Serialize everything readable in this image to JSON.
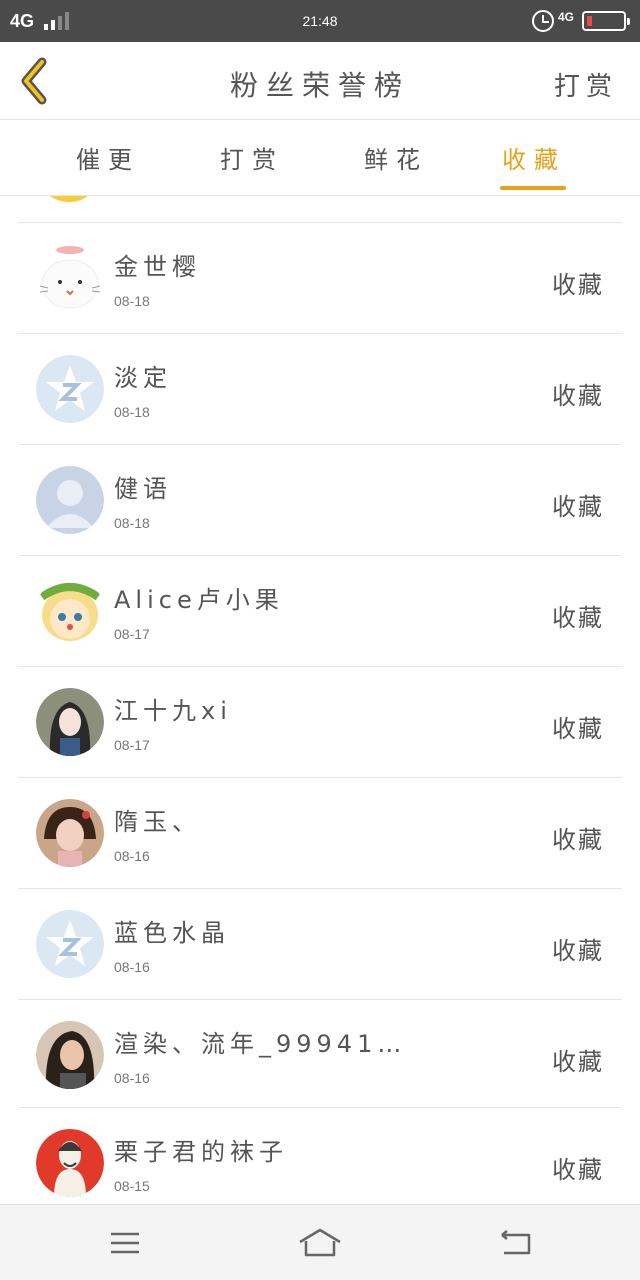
{
  "status_bar": {
    "network": "4G",
    "time": "21:48",
    "network_right": "4G",
    "icons": [
      "signal-icon",
      "alarm-icon",
      "battery-icon"
    ]
  },
  "header": {
    "back_icon": "chevron-left-icon",
    "title": "粉丝荣誉榜",
    "right_action": "打赏"
  },
  "tabs": [
    {
      "label": "催更",
      "active": false
    },
    {
      "label": "打赏",
      "active": false
    },
    {
      "label": "鲜花",
      "active": false
    },
    {
      "label": "收藏",
      "active": true
    }
  ],
  "accent_color": "#e8a21a",
  "fans": [
    {
      "name": "金世樱",
      "date": "08-18",
      "action": "收藏"
    },
    {
      "name": "淡定",
      "date": "08-18",
      "action": "收藏"
    },
    {
      "name": "健语",
      "date": "08-18",
      "action": "收藏"
    },
    {
      "name": "Alice卢小果",
      "date": "08-17",
      "action": "收藏"
    },
    {
      "name": "江十九xi",
      "date": "08-17",
      "action": "收藏"
    },
    {
      "name": "隋玉、",
      "date": "08-16",
      "action": "收藏"
    },
    {
      "name": "蓝色水晶",
      "date": "08-16",
      "action": "收藏"
    },
    {
      "name": "渲染、流年_99941…",
      "date": "08-16",
      "action": "收藏"
    },
    {
      "name": "栗子君的袜子",
      "date": "08-15",
      "action": "收藏"
    }
  ],
  "bottom_nav": [
    "menu-icon",
    "home-icon",
    "back-icon"
  ]
}
